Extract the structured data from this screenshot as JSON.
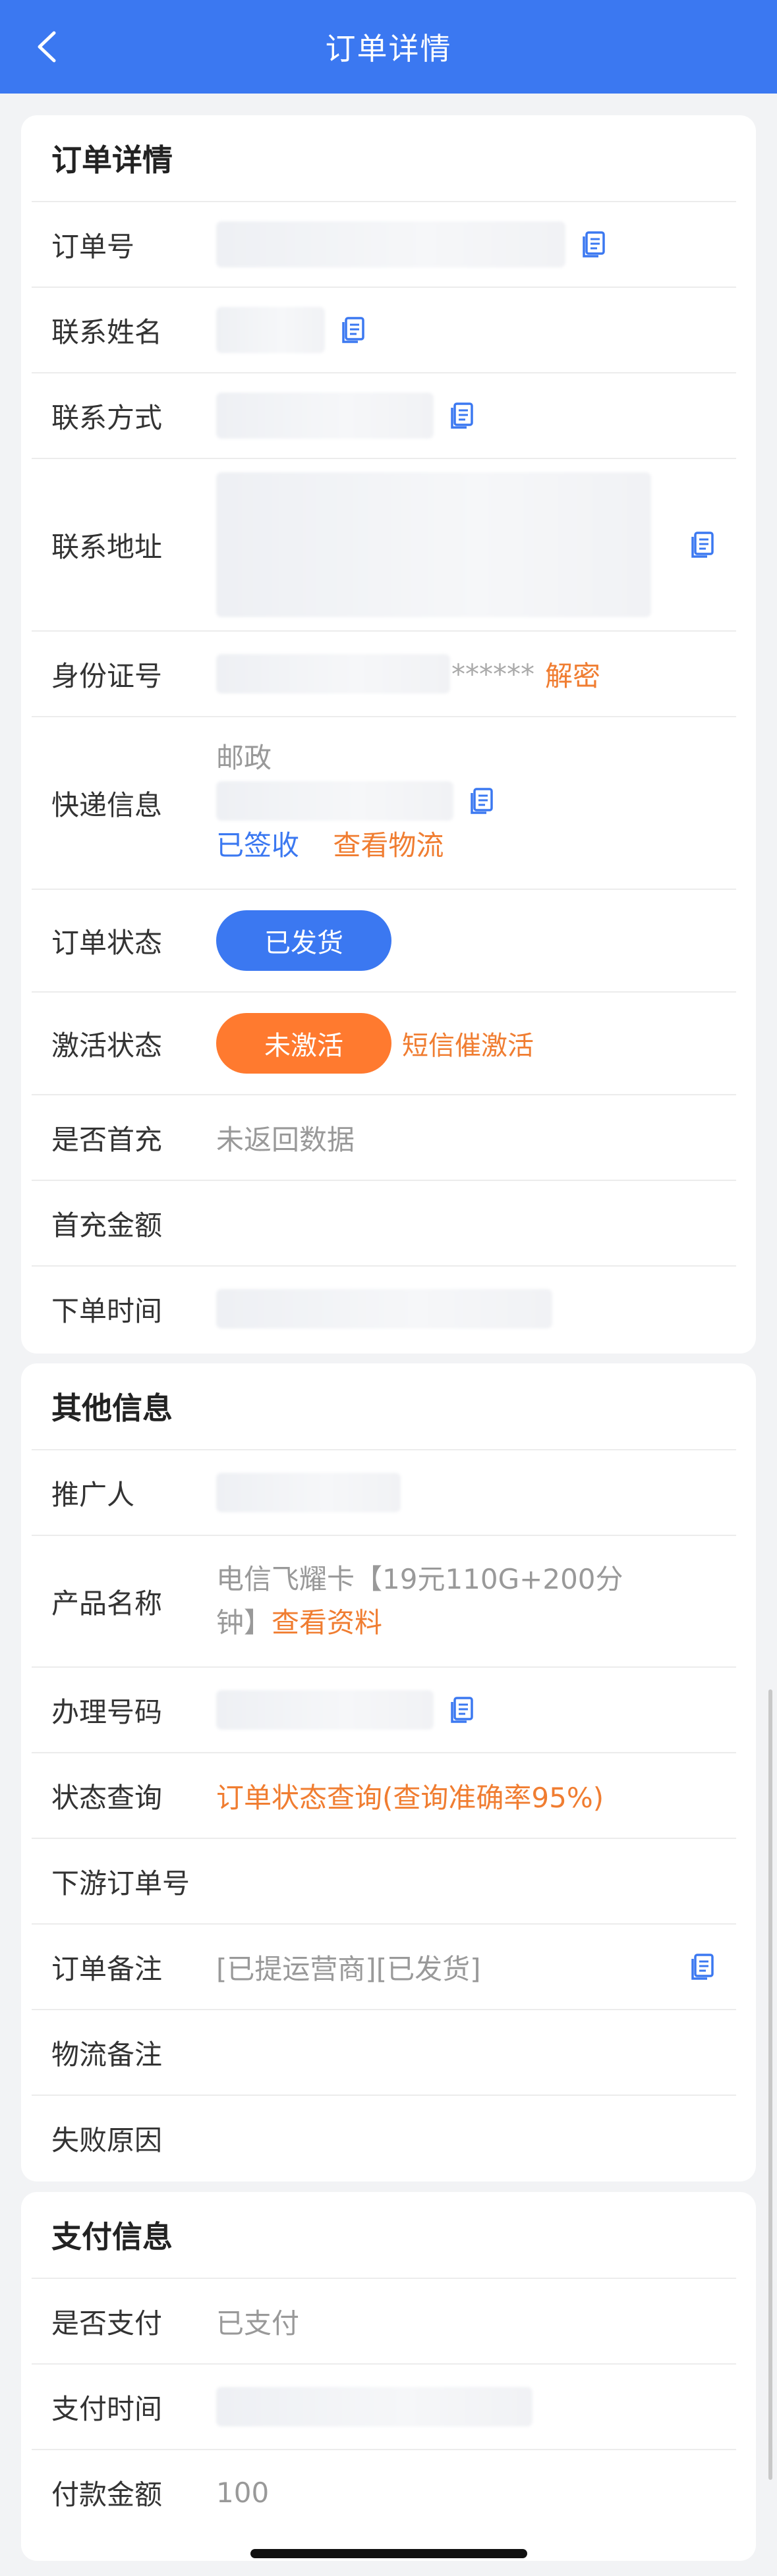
{
  "header": {
    "title": "订单详情"
  },
  "order": {
    "title": "订单详情",
    "rows": {
      "order_no": "订单号",
      "contact_name": "联系姓名",
      "contact_method": "联系方式",
      "contact_address": "联系地址",
      "id_card": "身份证号",
      "express": "快递信息",
      "order_status": "订单状态",
      "activation_status": "激活状态",
      "first_recharge": "是否首充",
      "first_recharge_amount": "首充金额",
      "order_time": "下单时间"
    },
    "id_mask": "******",
    "decrypt_label": "解密",
    "express_company": "邮政",
    "signed_label": "已签收",
    "view_logistics_label": "查看物流",
    "order_status_value": "已发货",
    "activation_status_value": "未激活",
    "sms_activate_label": "短信催激活",
    "first_recharge_value": "未返回数据"
  },
  "other": {
    "title": "其他信息",
    "rows": {
      "promoter": "推广人",
      "product_name": "产品名称",
      "handle_number": "办理号码",
      "status_query": "状态查询",
      "downstream_order_no": "下游订单号",
      "order_remark": "订单备注",
      "logistics_remark": "物流备注",
      "fail_reason": "失败原因"
    },
    "product_name_value": "电信飞耀卡【19元110G+200分钟】",
    "view_info_label": "查看资料",
    "status_query_value": "订单状态查询(查询准确率95%)",
    "order_remark_value": "[已提运营商][已发货]"
  },
  "payment": {
    "title": "支付信息",
    "rows": {
      "is_paid": "是否支付",
      "pay_time": "支付时间",
      "pay_amount": "付款金额"
    },
    "is_paid_value": "已支付",
    "pay_amount_value": "100"
  },
  "colors": {
    "primary": "#3b78f1",
    "accent": "#f07d31",
    "pill_orange": "#ff7a2f"
  }
}
